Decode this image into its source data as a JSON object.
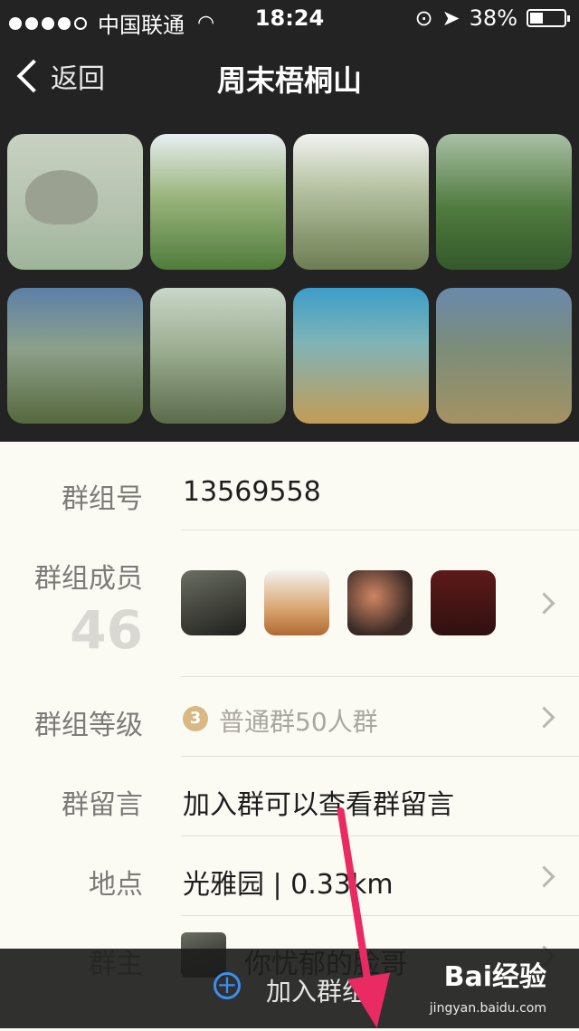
{
  "status_bar": {
    "carrier": "中国联通",
    "time": "18:24",
    "battery": "38%",
    "battery_level": 0.38,
    "icons": [
      "signal-dots-icon",
      "wifi-icon",
      "rotation-lock-icon",
      "location-arrow-icon",
      "battery-icon"
    ]
  },
  "nav": {
    "back_label": "返回",
    "title": "周末梧桐山"
  },
  "photos": [
    {
      "name": "photo-1"
    },
    {
      "name": "photo-2"
    },
    {
      "name": "photo-3"
    },
    {
      "name": "photo-4"
    },
    {
      "name": "photo-5"
    },
    {
      "name": "photo-6"
    },
    {
      "name": "photo-7"
    },
    {
      "name": "photo-8"
    }
  ],
  "info": {
    "group_id_label": "群组号",
    "group_id_value": "13569558",
    "members_label": "群组成员",
    "members_count": "46",
    "level_label": "群组等级",
    "level_badge": "3",
    "level_value": "普通群50人群",
    "message_label": "群留言",
    "message_value": "加入群可以查看群留言",
    "location_label": "地点",
    "location_value": "光雅园 | 0.33km",
    "owner_label": "群主",
    "owner_value": "你忧郁的脸哥"
  },
  "bottom_bar": {
    "join_label": "加入群组",
    "watermark": "Bai经验",
    "watermark_sub": "jingyan.baidu.com"
  },
  "colors": {
    "accent_blue": "#3a8ff0",
    "annotation_pink": "#ea2a63",
    "header_bg": "#232323"
  }
}
